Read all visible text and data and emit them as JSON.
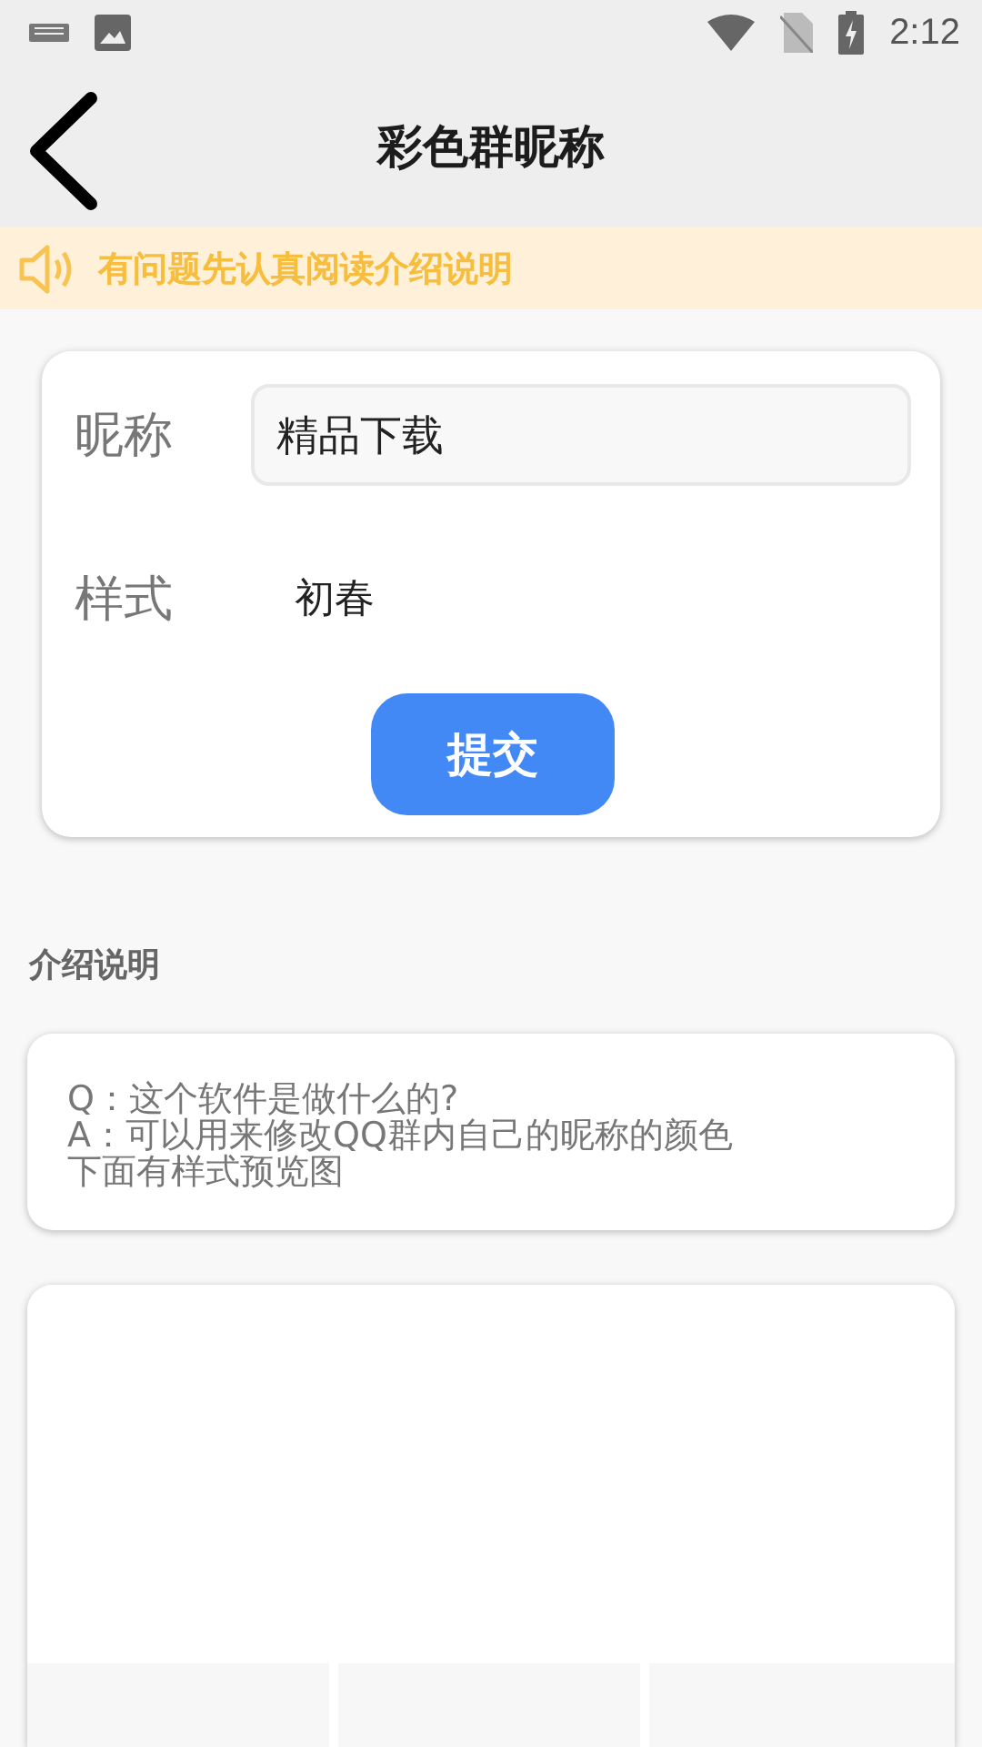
{
  "status_bar": {
    "time": "2:12"
  },
  "header": {
    "title": "彩色群昵称"
  },
  "notice": {
    "text": "有问题先认真阅读介绍说明"
  },
  "form": {
    "nickname_label": "昵称",
    "nickname_value": "精品下载",
    "style_label": "样式",
    "style_value": "初春",
    "submit": "提交"
  },
  "intro": {
    "heading": "介绍说明",
    "lines": [
      "Q：这个软件是做什么的?",
      "A：可以用来修改QQ群内自己的昵称的颜色",
      "下面有样式预览图"
    ]
  }
}
